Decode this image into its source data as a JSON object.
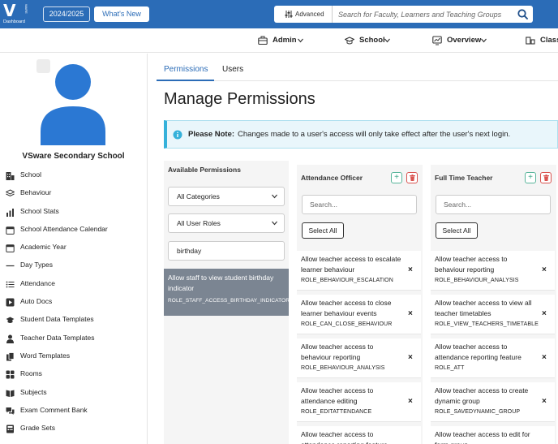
{
  "topbar": {
    "logo_text": "V",
    "logo_side": "WARE",
    "logo_sub": "Dashboard",
    "year_label": "2024/2025",
    "whats_new_label": "What's New",
    "advanced_label": "Advanced",
    "search_placeholder": "Search for Faculty, Learners and Teaching Groups"
  },
  "nav": {
    "items": [
      {
        "label": "Admin",
        "icon": "briefcase-icon"
      },
      {
        "label": "School",
        "icon": "graduation-cap-icon"
      },
      {
        "label": "Overview",
        "icon": "chart-icon"
      },
      {
        "label": "Class",
        "icon": "class-icon"
      }
    ]
  },
  "sidebar": {
    "school_name": "VSware Secondary School",
    "items": [
      {
        "label": "School",
        "icon": "building-icon"
      },
      {
        "label": "Behaviour",
        "icon": "layers-icon"
      },
      {
        "label": "School Stats",
        "icon": "bar-chart-icon"
      },
      {
        "label": "School Attendance Calendar",
        "icon": "calendar-icon"
      },
      {
        "label": "Academic Year",
        "icon": "calendar-icon"
      },
      {
        "label": "Day Types",
        "icon": "lines-icon"
      },
      {
        "label": "Attendance",
        "icon": "list-icon"
      },
      {
        "label": "Auto Docs",
        "icon": "play-icon"
      },
      {
        "label": "Student Data Templates",
        "icon": "graduation-cap-icon"
      },
      {
        "label": "Teacher Data Templates",
        "icon": "person-icon"
      },
      {
        "label": "Word Templates",
        "icon": "files-icon"
      },
      {
        "label": "Rooms",
        "icon": "grid-icon"
      },
      {
        "label": "Subjects",
        "icon": "book-icon"
      },
      {
        "label": "Exam Comment Bank",
        "icon": "comments-icon"
      },
      {
        "label": "Grade Sets",
        "icon": "calculator-icon"
      }
    ]
  },
  "main": {
    "tabs": [
      {
        "label": "Permissions",
        "active": true
      },
      {
        "label": "Users",
        "active": false
      }
    ],
    "title": "Manage Permissions",
    "note": {
      "label": "Please Note:",
      "text": "Changes made to a user's access will only take effect after the user's next login."
    }
  },
  "available": {
    "title": "Available Permissions",
    "category_select": "All Categories",
    "role_select": "All User Roles",
    "filter_value": "birthday",
    "items": [
      {
        "title": "Allow staff to view student birthday indicator",
        "code": "ROLE_STAFF_ACCESS_BIRTHDAY_INDICATOR"
      }
    ]
  },
  "roles": [
    {
      "name": "Attendance Officer",
      "search_placeholder": "Search...",
      "select_all_label": "Select All",
      "permissions": [
        {
          "title": "Allow teacher access to escalate learner behaviour",
          "code": "ROLE_BEHAVIOUR_ESCALATION"
        },
        {
          "title": "Allow teacher access to close learner behaviour events",
          "code": "ROLE_CAN_CLOSE_BEHAVIOUR"
        },
        {
          "title": "Allow teacher access to behaviour reporting",
          "code": "ROLE_BEHAVIOUR_ANALYSIS"
        },
        {
          "title": "Allow teacher access to attendance editing",
          "code": "ROLE_EDITATTENDANCE"
        },
        {
          "title": "Allow teacher access to attendance reporting feature",
          "code": ""
        }
      ]
    },
    {
      "name": "Full Time Teacher",
      "search_placeholder": "Search...",
      "select_all_label": "Select All",
      "permissions": [
        {
          "title": "Allow teacher access to behaviour reporting",
          "code": "ROLE_BEHAVIOUR_ANALYSIS"
        },
        {
          "title": "Allow teacher access to view all teacher timetables",
          "code": "ROLE_VIEW_TEACHERS_TIMETABLE"
        },
        {
          "title": "Allow teacher access to attendance reporting feature",
          "code": "ROLE_ATT"
        },
        {
          "title": "Allow teacher access to create dynamic group",
          "code": "ROLE_SAVEDYNAMIC_GROUP"
        },
        {
          "title": "Allow teacher access to edit for form group",
          "code": ""
        }
      ]
    }
  ],
  "colors": {
    "brand": "#2b6cb7",
    "info_accent": "#35b1da",
    "delete": "#d9534f",
    "add": "#3aa685"
  }
}
